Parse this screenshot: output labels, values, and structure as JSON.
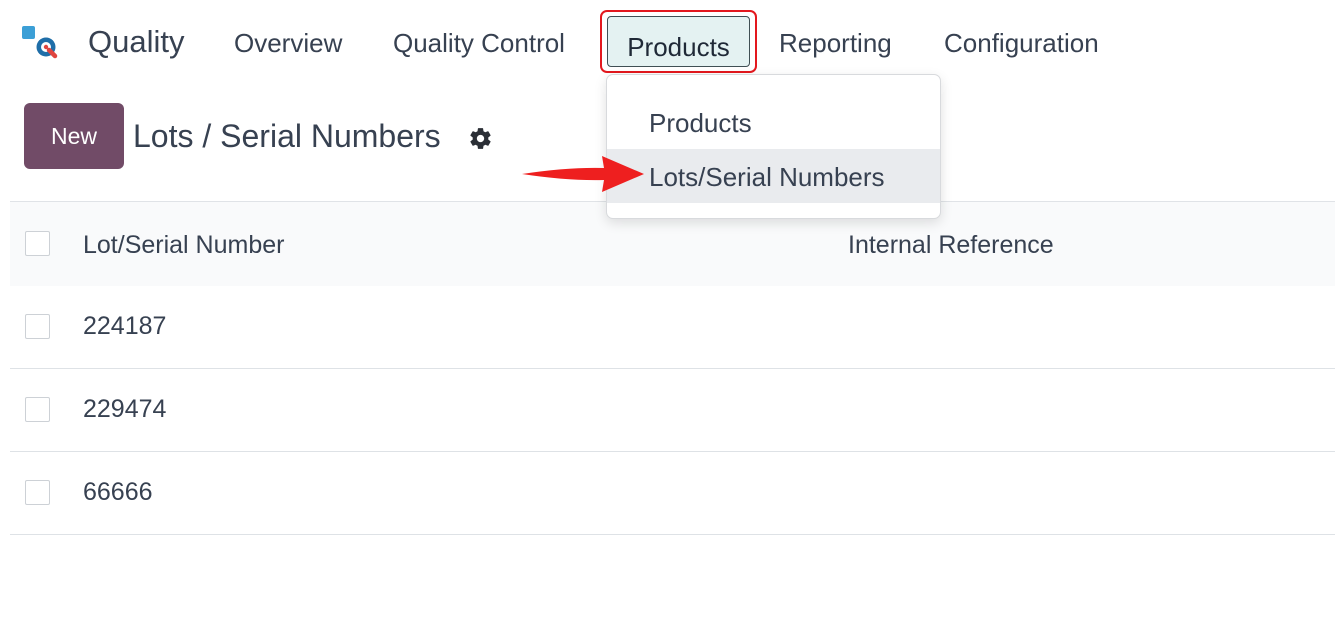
{
  "app": {
    "name": "Quality"
  },
  "nav": {
    "items": [
      {
        "label": "Overview"
      },
      {
        "label": "Quality Control"
      },
      {
        "label": "Products"
      },
      {
        "label": "Reporting"
      },
      {
        "label": "Configuration"
      }
    ]
  },
  "dropdown": {
    "items": [
      {
        "label": "Products"
      },
      {
        "label": "Lots/Serial Numbers"
      }
    ]
  },
  "control_panel": {
    "new_label": "New",
    "title": "Lots / Serial Numbers"
  },
  "list": {
    "columns": {
      "lot": "Lot/Serial Number",
      "ref": "Internal Reference"
    },
    "rows": [
      {
        "lot": "224187",
        "ref": ""
      },
      {
        "lot": "229474",
        "ref": ""
      },
      {
        "lot": "66666",
        "ref": ""
      }
    ]
  },
  "colors": {
    "brand": "#714b67",
    "highlight": "#e3181e",
    "active_tab_bg": "#e4f2f2"
  }
}
